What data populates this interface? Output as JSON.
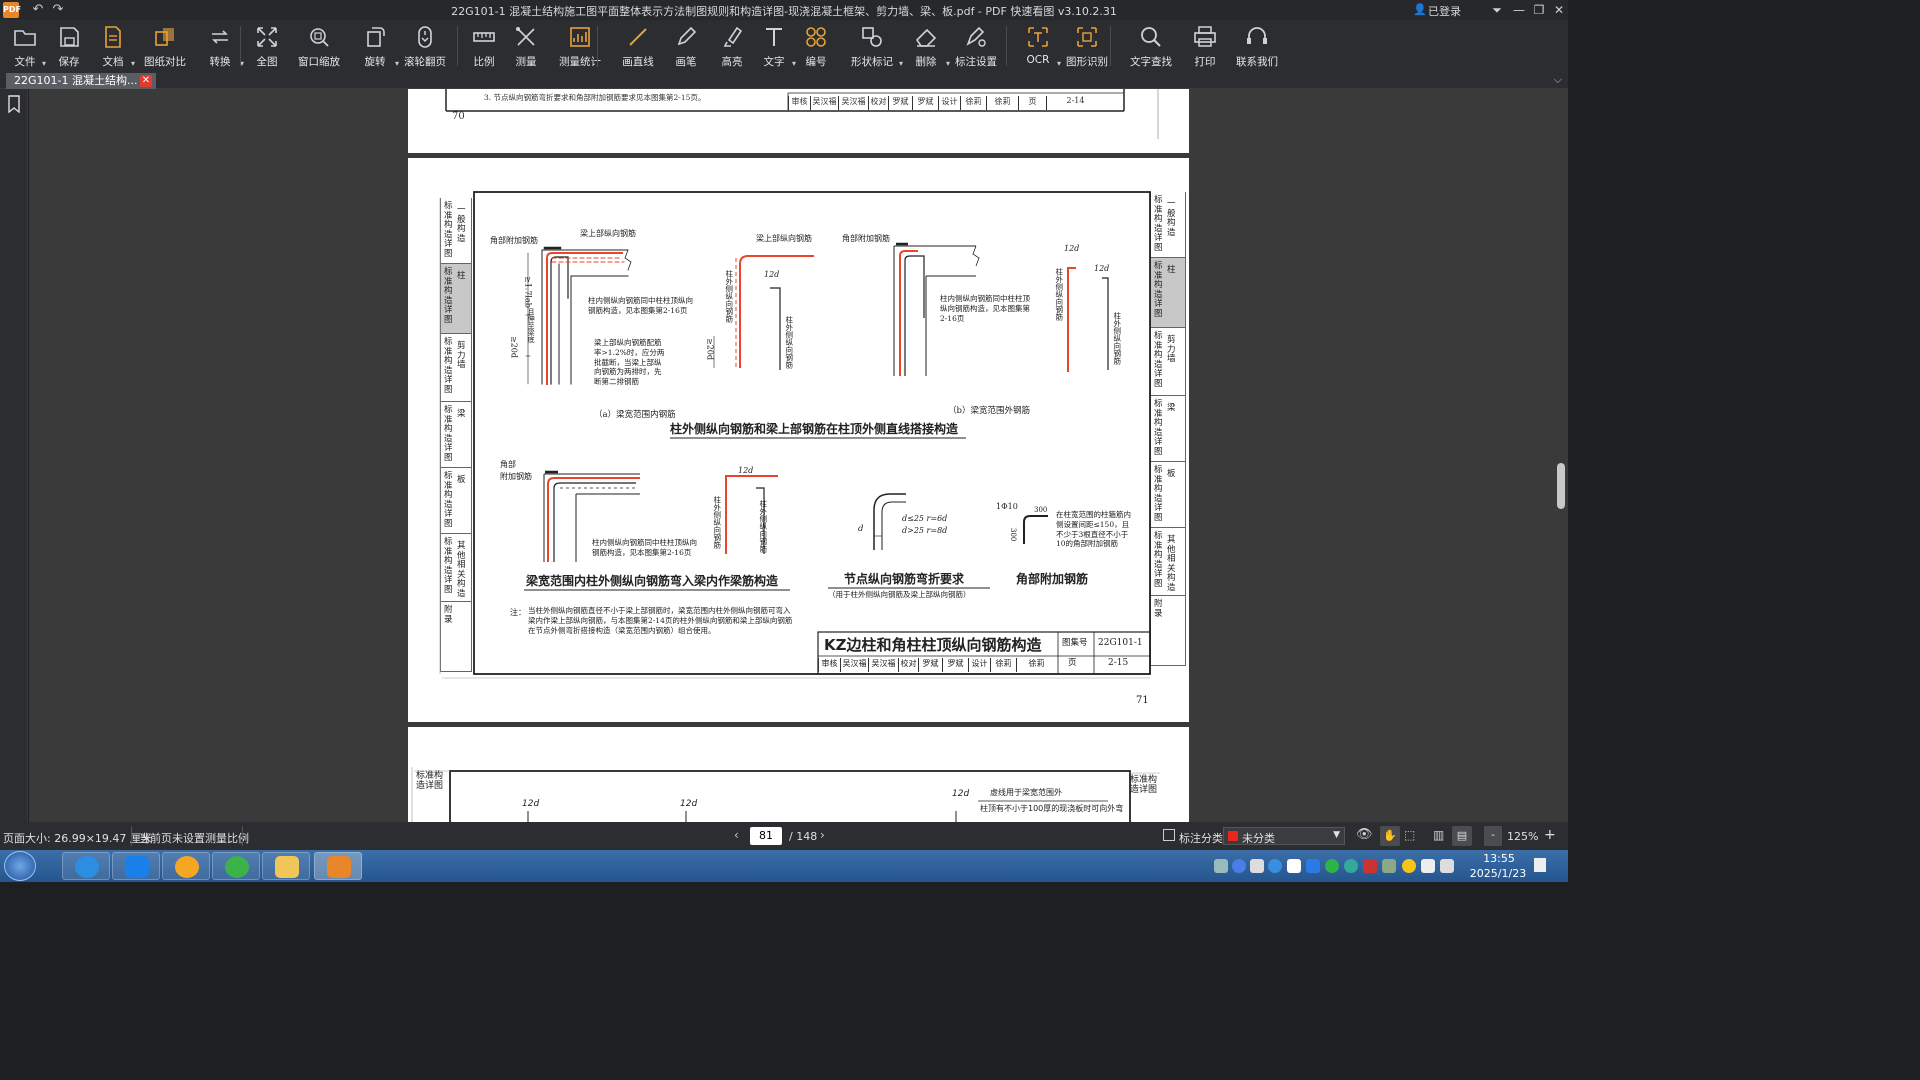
{
  "window": {
    "title": "22G101-1 混凝土结构施工图平面整体表示方法制图规则和构造详图-现浇混凝土框架、剪力墙、梁、板.pdf - PDF 快速看图 v3.10.2.31",
    "logo_text": "PDF",
    "user_status": "已登录"
  },
  "toolbar": [
    {
      "label": "文件",
      "icon": "folder-icon"
    },
    {
      "label": "保存",
      "icon": "save-icon"
    },
    {
      "label": "文档",
      "icon": "document-icon"
    },
    {
      "label": "图纸对比",
      "icon": "compare-icon"
    },
    {
      "label": "转换",
      "icon": "convert-icon"
    },
    {
      "label": "全图",
      "icon": "fit-all-icon"
    },
    {
      "label": "窗口缩放",
      "icon": "window-zoom-icon"
    },
    {
      "label": "旋转",
      "icon": "rotate-icon"
    },
    {
      "label": "滚轮翻页",
      "icon": "scroll-page-icon"
    },
    {
      "label": "比例",
      "icon": "scale-icon"
    },
    {
      "label": "测量",
      "icon": "measure-icon"
    },
    {
      "label": "测量统计",
      "icon": "measure-stats-icon"
    },
    {
      "label": "画直线",
      "icon": "line-icon"
    },
    {
      "label": "画笔",
      "icon": "pen-icon"
    },
    {
      "label": "高亮",
      "icon": "highlight-icon"
    },
    {
      "label": "文字",
      "icon": "text-icon"
    },
    {
      "label": "编号",
      "icon": "number-icon"
    },
    {
      "label": "形状标记",
      "icon": "shape-mark-icon"
    },
    {
      "label": "删除",
      "icon": "eraser-icon"
    },
    {
      "label": "标注设置",
      "icon": "annotation-settings-icon"
    },
    {
      "label": "OCR",
      "icon": "ocr-icon"
    },
    {
      "label": "图形识别",
      "icon": "shape-recognition-icon"
    },
    {
      "label": "文字查找",
      "icon": "search-icon"
    },
    {
      "label": "打印",
      "icon": "print-icon"
    },
    {
      "label": "联系我们",
      "icon": "headset-icon"
    }
  ],
  "tab": {
    "label": "22G101-1 混凝土结构...",
    "close": "✕"
  },
  "document": {
    "page70": {
      "note3": "3. 节点纵向钢筋弯折要求和角部附加钢筋要求见本图集第2-15页。",
      "title_row": [
        "审核",
        "吴汉福",
        "吴汉福",
        "校对",
        "罗斌",
        "罗斌",
        "设计",
        "徐莉",
        "徐莉",
        "页",
        "2-14"
      ],
      "page_number": "70"
    },
    "page71": {
      "side_left": [
        {
          "main": "标准构造详图",
          "sub": "一般构造",
          "active": false
        },
        {
          "main": "标准构造详图",
          "sub": "柱",
          "active": true
        },
        {
          "main": "标准构造详图",
          "sub": "剪力墙",
          "active": false
        },
        {
          "main": "标准构造详图",
          "sub": "梁",
          "active": false
        },
        {
          "main": "标准构造详图",
          "sub": "板",
          "active": false
        },
        {
          "main": "标准构造详图",
          "sub": "其他相关构造",
          "active": false
        },
        {
          "main": "附录",
          "sub": "",
          "active": false
        }
      ],
      "side_right": [
        {
          "main": "标准构造详图",
          "sub": "一般构造",
          "active": false
        },
        {
          "main": "标准构造详图",
          "sub": "柱",
          "active": true
        },
        {
          "main": "标准构造详图",
          "sub": "剪力墙",
          "active": false
        },
        {
          "main": "标准构造详图",
          "sub": "梁",
          "active": false
        },
        {
          "main": "标准构造详图",
          "sub": "板",
          "active": false
        },
        {
          "main": "标准构造详图",
          "sub": "其他相关构造",
          "active": false
        },
        {
          "main": "附录",
          "sub": "",
          "active": false
        }
      ],
      "labels": {
        "corner_rebar_a": "角部附加钢筋",
        "beam_top_rebar_a": "梁上部纵向钢筋",
        "len_a": "≥1.7lab",
        "len_a_note": "且伸至梁底",
        "col_inner_a": "柱内侧纵向钢筋同中柱柱顶纵向钢筋构造，见本图集第2-16页",
        "beam_ratio_a": "梁上部纵向钢筋配筋率>1.2%时，应分两批截断，当梁上部纵向钢筋为两排时，先断第二排钢筋",
        "len20d": "≥20d",
        "beam_top_rebar_a2": "梁上部纵向钢筋",
        "d12_a": "12d",
        "col_outer_a": "柱外侧纵向钢筋",
        "col_outer_a2": "柱外侧纵向钢筋",
        "len20d_b": "≥20d",
        "caption_a": "（a）梁宽范围内钢筋",
        "corner_rebar_b": "角部附加钢筋",
        "col_inner_b": "柱内侧纵向钢筋同中柱柱顶纵向钢筋构造，见本图集第2-16页",
        "d12_b1": "12d",
        "d12_b2": "12d",
        "col_outer_b": "柱外侧纵向钢筋",
        "col_outer_b2": "柱外侧纵向钢筋",
        "caption_b": "（b）梁宽范围外钢筋",
        "section1_title": "柱外侧纵向钢筋和梁上部钢筋在柱顶外侧直线搭接构造",
        "corner_rebar_c1": "角部",
        "corner_rebar_c2": "附加钢筋",
        "col_inner_c": "柱内侧纵向钢筋同中柱柱顶纵向钢筋构造，见本图集第2-16页",
        "d12_c": "12d",
        "col_outer_c": "柱外侧纵向钢筋",
        "col_outer_c2": "柱外侧纵向钢筋",
        "section2_title": "梁宽范围内柱外侧纵向钢筋弯入梁内作梁筋构造",
        "bend_d": "d",
        "bend_rule1": "d≤25   r=6d",
        "bend_rule2": "d>25   r=8d",
        "section3_title": "节点纵向钢筋弯折要求",
        "section3_sub": "（用于柱外侧纵向钢筋及梁上部纵向钢筋）",
        "corner_add_spec": "1Φ10",
        "corner_add_300a": "300",
        "corner_add_300b": "300",
        "corner_add_note": "在柱宽范围的柱箍筋内侧设置间距≤150，且不少于3根直径不小于10的角部附加钢筋",
        "section4_title": "角部附加钢筋",
        "note_label": "注：",
        "note_text": "当柱外侧纵向钢筋直径不小于梁上部钢筋时，梁宽范围内柱外侧纵向钢筋可弯入梁内作梁上部纵向钢筋，与本图集第2-14页的柱外侧纵向钢筋和梁上部纵向钢筋在节点外侧弯折搭接构造（梁宽范围内钢筋）组合使用。",
        "drawing_title": "KZ边柱和角柱柱顶纵向钢筋构造",
        "atlas_label": "图集号",
        "atlas_no": "22G101-1",
        "page_label": "页",
        "page_code": "2-15",
        "page_number": "71"
      },
      "title_row": [
        "审核",
        "吴汉福",
        "吴汉福",
        "校对",
        "罗斌",
        "罗斌",
        "设计",
        "徐莉",
        "徐莉"
      ]
    },
    "page72": {
      "side_left": [
        {
          "main": "标准构造详图",
          "sub": "一般构造"
        }
      ],
      "side_right": [
        {
          "main": "标准构造详图",
          "sub": "一般构造"
        }
      ],
      "d12a": "12d",
      "d12b": "12d",
      "d12c": "12d",
      "note1": "虚线用于梁宽范围外",
      "note2": "柱顶有不小于100厚的现浇板时可向外弯"
    }
  },
  "status": {
    "page_size": "页面大小: 26.99×19.47 厘米",
    "scale": "当前页未设置测量比例",
    "current_page": "81",
    "total_pages": "/ 148",
    "annot_category_label": "标注分类",
    "annot_category_value": "未分类",
    "zoom_minus": "-",
    "zoom": "125%",
    "zoom_plus": "+"
  },
  "taskbar": {
    "time": "13:55",
    "date": "2025/1/23",
    "apps": [
      "start-button",
      "browser-360-icon",
      "dingtalk-icon",
      "cloud-icon",
      "ie-icon",
      "file-explorer-icon",
      "pdf-app-icon"
    ]
  },
  "colors": {
    "accent_red": "#e8452c",
    "active_tab": "#c8c8c8",
    "titlebar": "#26282c",
    "toolbar": "#2b2d31"
  }
}
